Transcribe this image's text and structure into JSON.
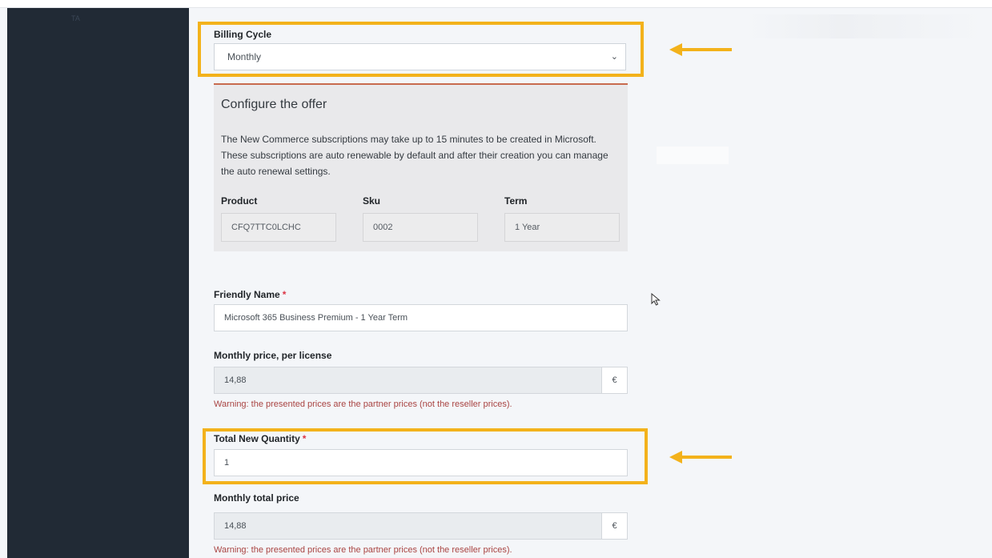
{
  "sidebar": {
    "ghost_text": "TA"
  },
  "billing_cycle": {
    "label": "Billing Cycle",
    "value": "Monthly"
  },
  "offer": {
    "title": "Configure the offer",
    "description": "The New Commerce subscriptions may take up to 15 minutes to be created in Microsoft. These subscriptions are auto renewable by default and after their creation you can manage the auto renewal settings.",
    "product_label": "Product",
    "product_value": "CFQ7TTC0LCHC",
    "sku_label": "Sku",
    "sku_value": "0002",
    "term_label": "Term",
    "term_value": "1 Year"
  },
  "friendly_name": {
    "label": "Friendly Name",
    "required_mark": "*",
    "value": "Microsoft 365 Business Premium - 1 Year Term"
  },
  "monthly_price": {
    "label": "Monthly price, per license",
    "value": "14,88",
    "currency": "€",
    "warning": "Warning: the presented prices are the partner prices (not the reseller prices)."
  },
  "quantity": {
    "label": "Total New Quantity",
    "required_mark": "*",
    "value": "1"
  },
  "monthly_total": {
    "label": "Monthly total price",
    "value": "14,88",
    "currency": "€",
    "warning": "Warning: the presented prices are the partner prices (not the reseller prices)."
  },
  "colors": {
    "highlight": "#f3b21b",
    "sidebar": "#212a35",
    "warning": "#a94442",
    "required": "#dc3545"
  },
  "icons": {
    "dropdown": "chevron-down-icon",
    "arrow": "arrow-left-icon",
    "cursor": "mouse-pointer-icon"
  }
}
